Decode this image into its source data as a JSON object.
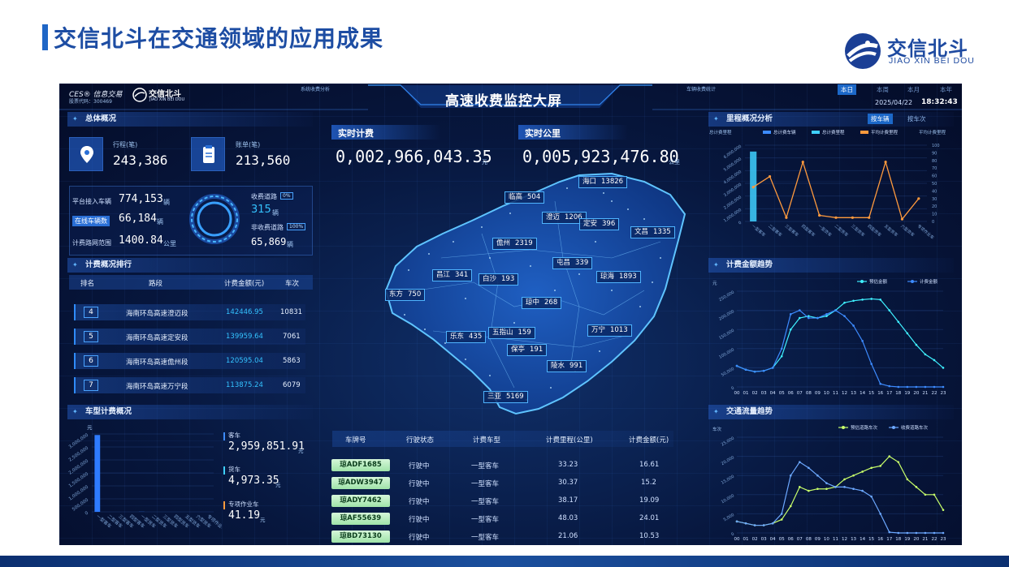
{
  "slide": {
    "title": "交信北斗在交通领域的应用成果",
    "brand_cn": "交信北斗",
    "brand_en": "JIAO XIN BEI DOU"
  },
  "dashboard": {
    "title": "高速收费监控大屏",
    "logo_left": "CES® 信息交易",
    "stock_code": "股票代码：300469",
    "logo_small_cn": "交信北斗",
    "logo_small_en": "JIAO XIN BEI DOU",
    "header_tab_left": "系统收费分析",
    "header_tab_right": "车辆收费统计",
    "period_tabs": [
      "本日",
      "本周",
      "本月",
      "本年"
    ],
    "date": "2025/04/22",
    "time": "18:32:43",
    "overview": {
      "title": "总体概况",
      "trips_label": "行程(笔)",
      "trips_value": "243,386",
      "bills_label": "账单(笔)",
      "bills_value": "213,560",
      "platform_vehicles_label": "平台接入车辆",
      "platform_vehicles_value": "774,153",
      "platform_vehicles_unit": "辆",
      "online_label": "在线车辆数",
      "online_value": "66,184",
      "online_unit": "辆",
      "range_label": "计费路网范围",
      "range_value": "1400.84",
      "range_unit": "公里",
      "toll_road_label": "收费道路",
      "toll_road_badge": "0%",
      "toll_road_value": "315",
      "toll_road_unit": "辆",
      "nontoll_label": "非收费道路",
      "nontoll_badge": "100%",
      "nontoll_value": "65,869",
      "nontoll_unit": "辆"
    },
    "ranking": {
      "title": "计费概况排行",
      "headers": [
        "排名",
        "路段",
        "计费金额(元)",
        "车次"
      ],
      "rows": [
        {
          "rank": "4",
          "road": "海南环岛高速澄迈段",
          "amount": "142446.95",
          "count": "10831"
        },
        {
          "rank": "5",
          "road": "海南环岛高速定安段",
          "amount": "139959.64",
          "count": "7061"
        },
        {
          "rank": "6",
          "road": "海南环岛高速儋州段",
          "amount": "120595.04",
          "count": "5863"
        },
        {
          "rank": "7",
          "road": "海南环岛高速万宁段",
          "amount": "113875.24",
          "count": "6079"
        }
      ]
    },
    "vehicle_type": {
      "title": "车型计费概况",
      "unit": "元",
      "yticks": [
        "3,000,000",
        "2,500,000",
        "2,000,000",
        "1,500,000",
        "1,000,000",
        "500,000",
        "0"
      ],
      "xcats": [
        "一型客车",
        "二型客车",
        "三型客车",
        "四型客车",
        "一型货车",
        "二型货车",
        "三型货车",
        "四型货车",
        "五型货车",
        "六型货车",
        "专项作业车"
      ],
      "bus_label": "客车",
      "bus_value": "2,959,851.91",
      "truck_label": "货车",
      "truck_value": "4,973.35",
      "special_label": "专项作业车",
      "special_value": "41.19",
      "yuan": "元"
    },
    "realtime": {
      "fee_label": "实时计费",
      "fee_value": "0,002,966,043.35",
      "fee_unit": "元",
      "km_label": "实时公里",
      "km_value": "0,005,923,476.80",
      "km_unit": "公里"
    },
    "map_cities": [
      {
        "name": "海口",
        "value": "13826"
      },
      {
        "name": "临高",
        "value": "504"
      },
      {
        "name": "澄迈",
        "value": "1206"
      },
      {
        "name": "定安",
        "value": "396"
      },
      {
        "name": "文昌",
        "value": "1335"
      },
      {
        "name": "儋州",
        "value": "2319"
      },
      {
        "name": "昌江",
        "value": "341"
      },
      {
        "name": "白沙",
        "value": "193"
      },
      {
        "name": "屯昌",
        "value": "339"
      },
      {
        "name": "琼海",
        "value": "1893"
      },
      {
        "name": "东方",
        "value": "750"
      },
      {
        "name": "琼中",
        "value": "268"
      },
      {
        "name": "乐东",
        "value": "435"
      },
      {
        "name": "五指山",
        "value": "159"
      },
      {
        "name": "万宁",
        "value": "1013"
      },
      {
        "name": "保亭",
        "value": "191"
      },
      {
        "name": "陵水",
        "value": "991"
      },
      {
        "name": "三亚",
        "value": "5169"
      }
    ],
    "vehicle_table": {
      "headers": [
        "车牌号",
        "行驶状态",
        "计费车型",
        "计费里程(公里)",
        "计费金额(元)"
      ],
      "rows": [
        {
          "plate": "琼ADF1685",
          "status": "行驶中",
          "type": "一型客车",
          "km": "33.23",
          "fee": "16.61"
        },
        {
          "plate": "琼ADW3947",
          "status": "行驶中",
          "type": "一型客车",
          "km": "30.37",
          "fee": "15.2"
        },
        {
          "plate": "琼ADY7462",
          "status": "行驶中",
          "type": "一型客车",
          "km": "38.17",
          "fee": "19.09"
        },
        {
          "plate": "琼AF55639",
          "status": "行驶中",
          "type": "一型客车",
          "km": "48.03",
          "fee": "24.01"
        },
        {
          "plate": "琼BD73130",
          "status": "行驶中",
          "type": "一型客车",
          "km": "21.06",
          "fee": "10.53"
        }
      ]
    },
    "mileage_panel": {
      "title": "里程概况分析",
      "tab_active": "按车辆",
      "tab_inactive": "按车次"
    },
    "fee_trend_panel": {
      "title": "计费金额趋势"
    },
    "traffic_panel": {
      "title": "交通流量趋势"
    }
  },
  "chart_data": [
    {
      "type": "bar",
      "title": "",
      "categories": [
        "一型客车",
        "二型客车",
        "三型客车",
        "四型客车",
        "一型货车",
        "二型货车",
        "三型货车",
        "四型货车",
        "五型货车",
        "六型货车",
        "专项作业车"
      ],
      "series": [
        {
          "values": [
            2959851.91,
            0,
            0,
            0,
            4973.35,
            0,
            0,
            0,
            0,
            0,
            41.19
          ]
        }
      ],
      "ylabel": "元",
      "ylim": [
        0,
        3000000
      ]
    },
    {
      "type": "line",
      "title": "",
      "categories": [
        "一型客车",
        "二型客车",
        "三型客车",
        "四型客车",
        "一型货车",
        "二型货车",
        "三型货车",
        "四型货车",
        "五型货车",
        "六型货车",
        "专项作业车"
      ],
      "legend": [
        "总计费车辆",
        "总计费里程",
        "平均计费里程"
      ],
      "yticks_left": [
        "6,000,000",
        "5,000,000",
        "4,000,000",
        "3,000,000",
        "2,000,000",
        "1,000,000",
        "0"
      ],
      "yticks_right": [
        "100",
        "90",
        "80",
        "70",
        "60",
        "50",
        "40",
        "30",
        "20",
        "10",
        "0"
      ],
      "left_unit": "总计费里程",
      "right_unit": "平均计费里程",
      "series": [
        {
          "name": "总计费里程",
          "type": "bar",
          "values": [
            5500000,
            0,
            0,
            0,
            0,
            0,
            0,
            0,
            0,
            0,
            0
          ]
        },
        {
          "name": "平均计费里程",
          "type": "line",
          "values": [
            45,
            59,
            5,
            78,
            8,
            5,
            5,
            5,
            78,
            3,
            30
          ]
        }
      ],
      "ylim": [
        0,
        6000000
      ],
      "y2lim": [
        0,
        100
      ]
    },
    {
      "type": "line",
      "title": "",
      "x": [
        "00",
        "01",
        "02",
        "03",
        "04",
        "05",
        "06",
        "07",
        "08",
        "09",
        "10",
        "11",
        "12",
        "13",
        "14",
        "15",
        "16",
        "17",
        "18",
        "19",
        "20",
        "21",
        "22",
        "23"
      ],
      "ylabel": "元",
      "yticks": [
        "250,000",
        "200,000",
        "150,000",
        "100,000",
        "50,000",
        "0"
      ],
      "ylim": [
        0,
        250000
      ],
      "series": [
        {
          "name": "预估金额",
          "values": [
            55000,
            45000,
            40000,
            42000,
            50000,
            80000,
            150000,
            180000,
            185000,
            180000,
            185000,
            200000,
            220000,
            225000,
            228000,
            230000,
            228000,
            200000,
            170000,
            140000,
            110000,
            85000,
            70000,
            50000
          ]
        },
        {
          "name": "计费金额",
          "values": [
            55000,
            45000,
            40000,
            42000,
            50000,
            100000,
            190000,
            200000,
            180000,
            180000,
            190000,
            200000,
            185000,
            160000,
            120000,
            60000,
            8000,
            2000,
            0,
            0,
            0,
            0,
            0,
            0
          ]
        }
      ]
    },
    {
      "type": "line",
      "title": "",
      "x": [
        "00",
        "01",
        "02",
        "03",
        "04",
        "05",
        "06",
        "07",
        "08",
        "09",
        "10",
        "11",
        "12",
        "13",
        "14",
        "15",
        "16",
        "17",
        "18",
        "19",
        "20",
        "21",
        "22",
        "23"
      ],
      "ylabel": "车次",
      "yticks": [
        "25,000",
        "20,000",
        "15,000",
        "10,000",
        "5,000",
        "0"
      ],
      "ylim": [
        0,
        25000
      ],
      "series": [
        {
          "name": "预估道路车次",
          "values": [
            3000,
            2500,
            2000,
            2000,
            2500,
            3500,
            7000,
            12000,
            11000,
            11500,
            11500,
            12000,
            14000,
            15000,
            16000,
            17000,
            17500,
            20000,
            18500,
            14000,
            12000,
            10000,
            10000,
            6000
          ]
        },
        {
          "name": "收费道路车次",
          "values": [
            3000,
            2500,
            2000,
            2000,
            2500,
            5000,
            15000,
            18500,
            17000,
            15000,
            13000,
            12000,
            12000,
            11500,
            11000,
            9500,
            5000,
            200,
            0,
            0,
            0,
            0,
            0,
            0
          ]
        }
      ]
    }
  ]
}
